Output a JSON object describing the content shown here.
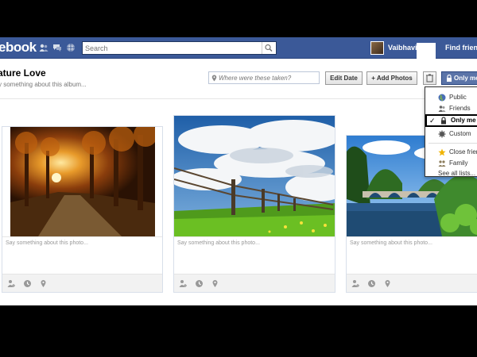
{
  "header": {
    "logo": "ebook",
    "search_placeholder": "Search",
    "username": "Vaibhavi",
    "find_friends": "Find friends",
    "jewels": [
      "friend-requests-icon",
      "messages-icon",
      "notifications-icon"
    ]
  },
  "album": {
    "title": "ature Love",
    "description": "y something about this album...",
    "location_placeholder": "Where were these taken?",
    "edit_date_label": "Edit Date",
    "add_photos_label": "+ Add Photos",
    "privacy_label": "Only me"
  },
  "photos": [
    {
      "caption_placeholder": "Say something about this photo...",
      "subject": "autumn forest path at sunset"
    },
    {
      "caption_placeholder": "Say something about this photo...",
      "subject": "blue sky over green meadow with wooden fence"
    },
    {
      "caption_placeholder": "Say something about this photo...",
      "subject": "stone arch bridge over river"
    }
  ],
  "privacy_menu": {
    "items": [
      {
        "label": "Public",
        "icon": "globe-icon",
        "selected": false
      },
      {
        "label": "Friends",
        "icon": "friends-icon",
        "selected": false
      },
      {
        "label": "Only me",
        "icon": "lock-icon",
        "selected": true
      },
      {
        "label": "Custom",
        "icon": "gear-icon",
        "selected": false
      }
    ],
    "lists": [
      {
        "label": "Close friends",
        "icon": "star-icon"
      },
      {
        "label": "Family",
        "icon": "family-icon"
      }
    ],
    "see_all": "See all lists..."
  },
  "colors": {
    "brand_blue": "#3b5998",
    "privacy_blue": "#5b74a8"
  }
}
